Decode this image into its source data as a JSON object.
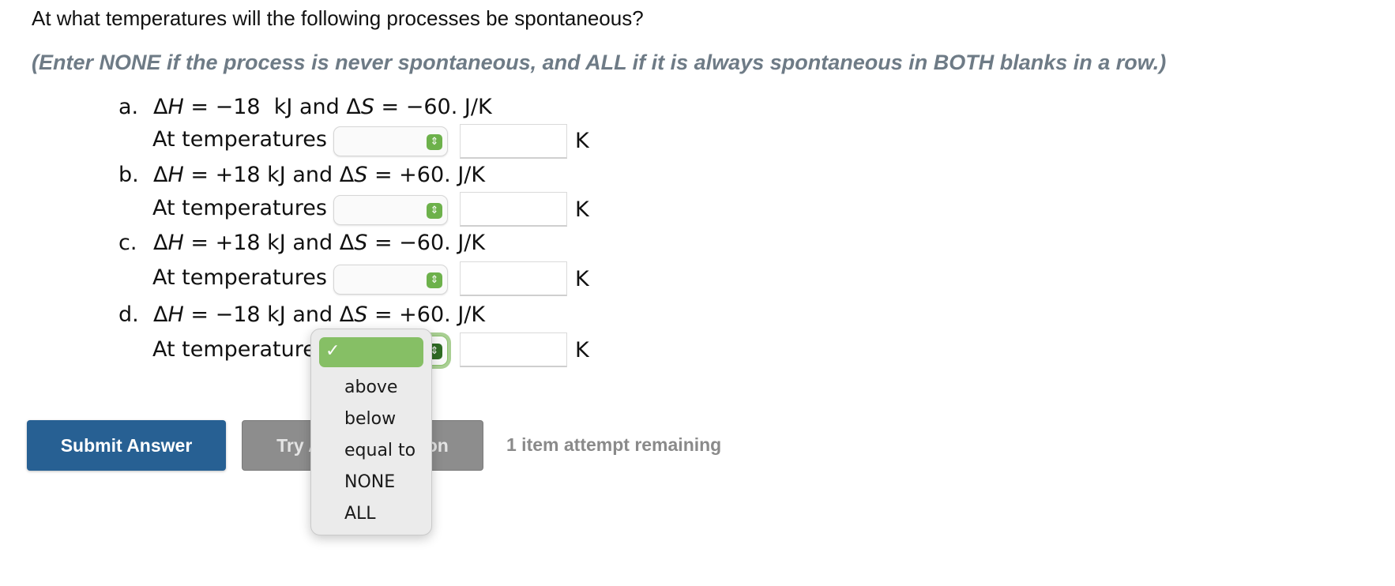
{
  "question": "At what temperatures will the following processes be spontaneous?",
  "instructions": "(Enter NONE if the process is never spontaneous, and ALL if it is always spontaneous in BOTH blanks in a row.)",
  "parts": [
    {
      "letter": "a.",
      "dh_value": "= −18  kJ",
      "ds_value": "= −60. J/K",
      "row_label": "At temperatures",
      "select_value": "",
      "input_value": "",
      "unit": "K"
    },
    {
      "letter": "b.",
      "dh_value": "= +18 kJ",
      "ds_value": "= +60. J/K",
      "row_label": "At temperatures",
      "select_value": "",
      "input_value": "",
      "unit": "K"
    },
    {
      "letter": "c.",
      "dh_value": "= +18 kJ",
      "ds_value": "= −60. J/K",
      "row_label": "At temperatures",
      "select_value": "",
      "input_value": "",
      "unit": "K"
    },
    {
      "letter": "d.",
      "dh_value": "= −18 kJ",
      "ds_value": "= +60. J/K",
      "row_label": "At temperatures",
      "select_value": "",
      "input_value": "",
      "unit": "K"
    }
  ],
  "symbols": {
    "delta": "Δ",
    "H": "H",
    "S": "S",
    "and": "and"
  },
  "dropdown": {
    "selected_mark": "✓",
    "options": [
      "above",
      "below",
      "equal to",
      "NONE",
      "ALL"
    ]
  },
  "buttons": {
    "submit": "Submit Answer",
    "try_another": "Try Another Version"
  },
  "attempts_text": "1 item attempt remaining",
  "colors": {
    "submit": "#276093",
    "try_another": "#8d8d8d",
    "select_accent": "#6db14b",
    "instructions": "#6e7b86"
  },
  "icons": {
    "stepper": "updown-chevron-icon",
    "check": "checkmark-icon"
  }
}
